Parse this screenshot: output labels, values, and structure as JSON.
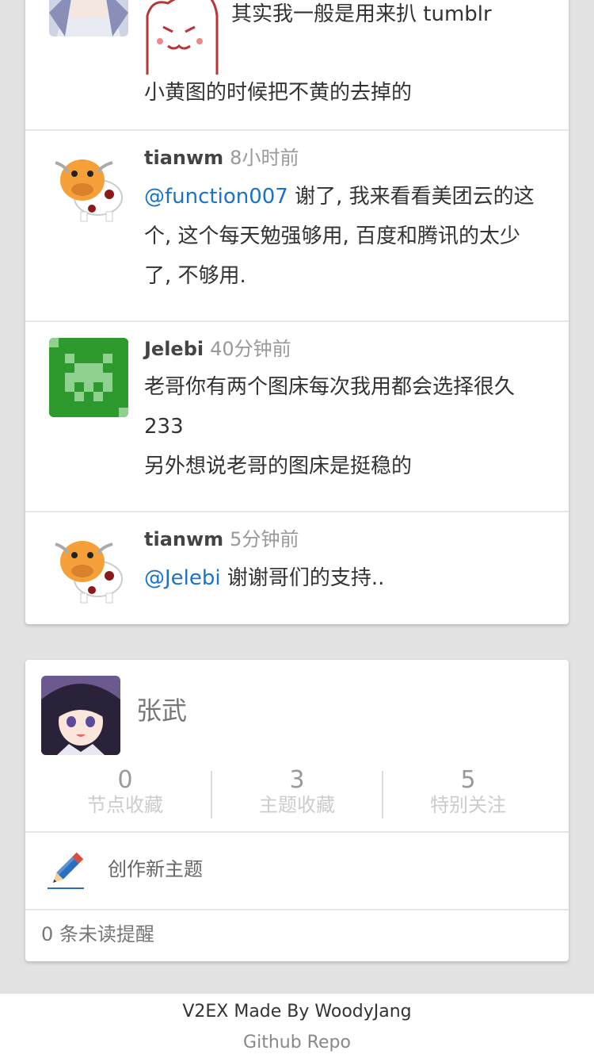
{
  "replies": [
    {
      "sticker_line": "其实我一般是用来扒 tumblr",
      "text_line": "小黄图的时候把不黄的去掉的"
    },
    {
      "username": "tianwm",
      "time": "8小时前",
      "mention": "@function007",
      "text": " 谢了, 我来看看美团云的这个, 这个每天勉强够用, 百度和腾讯的太少了, 不够用."
    },
    {
      "username": "Jelebi",
      "time": "40分钟前",
      "text": "老哥你有两个图床每次我用都会选择很久 233",
      "text2": "另外想说老哥的图床是挺稳的"
    },
    {
      "username": "tianwm",
      "time": "5分钟前",
      "mention": "@Jelebi",
      "text": " 谢谢哥们的支持.."
    }
  ],
  "profile": {
    "name": "张武",
    "stats": [
      {
        "value": "0",
        "label": "节点收藏"
      },
      {
        "value": "3",
        "label": "主题收藏"
      },
      {
        "value": "5",
        "label": "特别关注"
      }
    ],
    "new_topic_label": "创作新主题",
    "notifications": "0 条未读提醒"
  },
  "footer": {
    "credit": "V2EX Made By WoodyJang",
    "repo_link": "Github Repo"
  },
  "colors": {
    "mention_link": "#1a73c9",
    "page_background": "#e2e2e2",
    "avatar_green": "#2e9a2e"
  },
  "icons": [
    "anime-avatar",
    "cat-sticker",
    "cow-avatar",
    "pixel-invader-avatar",
    "girl-avatar",
    "pencil-icon"
  ]
}
